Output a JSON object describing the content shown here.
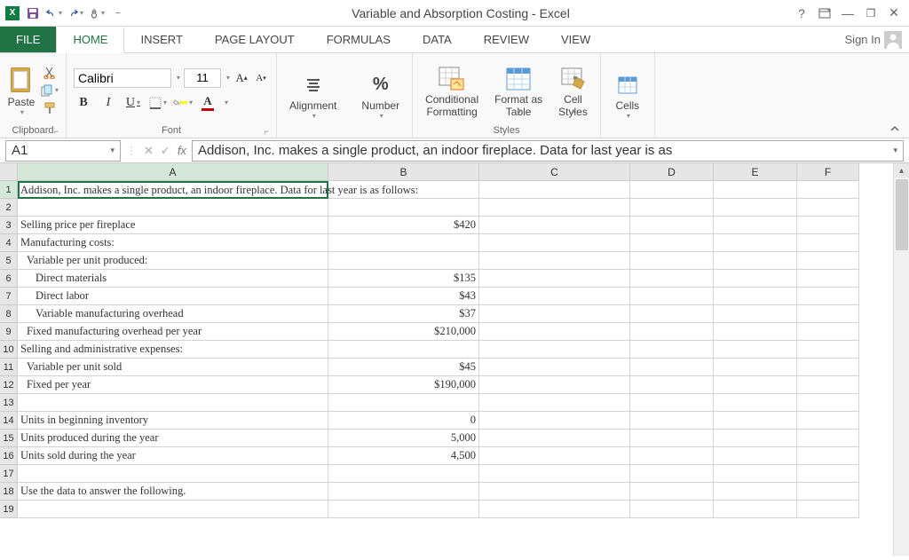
{
  "title": "Variable and Absorption Costing - Excel",
  "qat": {
    "save": "save-icon",
    "undo": "undo-icon",
    "redo": "redo-icon",
    "touch": "touch-mode-icon"
  },
  "window": {
    "help": "?",
    "ribbon_opts": "▭",
    "minimize": "—",
    "restore": "❐",
    "close": "✕"
  },
  "tabs": {
    "file": "FILE",
    "home": "HOME",
    "insert": "INSERT",
    "page_layout": "PAGE LAYOUT",
    "formulas": "FORMULAS",
    "data": "DATA",
    "review": "REVIEW",
    "view": "VIEW"
  },
  "signin": "Sign In",
  "ribbon": {
    "clipboard": {
      "paste": "Paste",
      "label": "Clipboard"
    },
    "font": {
      "name": "Calibri",
      "size": "11",
      "label": "Font"
    },
    "alignment": {
      "btn": "Alignment"
    },
    "number": {
      "btn": "Number",
      "symbol": "%"
    },
    "styles": {
      "conditional": "Conditional\nFormatting",
      "format_table": "Format as\nTable",
      "cell_styles": "Cell\nStyles",
      "label": "Styles"
    },
    "cells": {
      "btn": "Cells"
    }
  },
  "name_box": "A1",
  "formula_content": "Addison, Inc. makes a single product, an indoor fireplace. Data for last year is as",
  "columns": [
    "A",
    "B",
    "C",
    "D",
    "E",
    "F"
  ],
  "rows": [
    {
      "n": "1",
      "a": "Addison, Inc. makes a single product, an indoor fireplace. Data for last year is as follows:",
      "b": "",
      "sel": true
    },
    {
      "n": "2",
      "a": "",
      "b": ""
    },
    {
      "n": "3",
      "a": "Selling price per fireplace",
      "b": "$420"
    },
    {
      "n": "4",
      "a": "Manufacturing costs:",
      "b": ""
    },
    {
      "n": "5",
      "a": "  Variable per unit produced:",
      "b": ""
    },
    {
      "n": "6",
      "a": "    Direct materials",
      "b": "$135"
    },
    {
      "n": "7",
      "a": "    Direct labor",
      "b": "$43"
    },
    {
      "n": "8",
      "a": "    Variable manufacturing overhead",
      "b": "$37"
    },
    {
      "n": "9",
      "a": "  Fixed manufacturing overhead per year",
      "b": "$210,000"
    },
    {
      "n": "10",
      "a": "Selling and administrative expenses:",
      "b": ""
    },
    {
      "n": "11",
      "a": "  Variable per unit sold",
      "b": "$45"
    },
    {
      "n": "12",
      "a": "  Fixed per year",
      "b": "$190,000"
    },
    {
      "n": "13",
      "a": "",
      "b": ""
    },
    {
      "n": "14",
      "a": "Units in beginning inventory",
      "b": "0"
    },
    {
      "n": "15",
      "a": "Units produced during the year",
      "b": "5,000"
    },
    {
      "n": "16",
      "a": "Units sold during the year",
      "b": "4,500"
    },
    {
      "n": "17",
      "a": "",
      "b": ""
    },
    {
      "n": "18",
      "a": "Use the data to answer the following.",
      "b": ""
    },
    {
      "n": "19",
      "a": "",
      "b": ""
    }
  ]
}
